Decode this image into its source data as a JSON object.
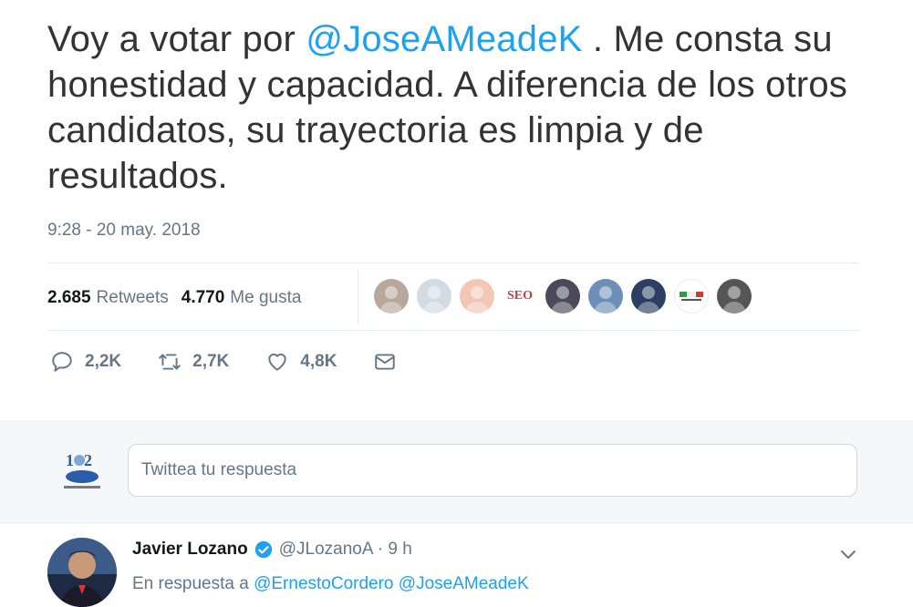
{
  "tweet": {
    "text_part1": "Voy a votar por ",
    "mention": "@JoseAMeadeK",
    "text_part2": " . Me consta su honestidad y capacidad. A diferencia de los otros candidatos, su trayectoria es limpia y de resultados.",
    "timestamp": "9:28 - 20 may. 2018"
  },
  "stats": {
    "retweets_count": "2.685",
    "retweets_label": "Retweets",
    "likes_count": "4.770",
    "likes_label": "Me gusta",
    "liker_avatars": [
      {
        "label": "",
        "bg": "#b9a79b"
      },
      {
        "label": "",
        "bg": "#d2dbe3"
      },
      {
        "label": "",
        "bg": "#f3c7b4"
      },
      {
        "label": "SEO",
        "bg": "#ffffff"
      },
      {
        "label": "",
        "bg": "#4a4a5a"
      },
      {
        "label": "",
        "bg": "#6c8fb8"
      },
      {
        "label": "",
        "bg": "#2c3e63"
      },
      {
        "label": "",
        "bg": "#ffffff"
      },
      {
        "label": "",
        "bg": "#555555"
      }
    ]
  },
  "actions": {
    "reply_count": "2,2K",
    "retweet_count": "2,7K",
    "like_count": "4,8K",
    "icons": [
      "reply-icon",
      "retweet-icon",
      "heart-icon",
      "message-icon"
    ]
  },
  "reply_box": {
    "placeholder": "Twittea tu respuesta"
  },
  "reply_tweet": {
    "author_name": "Javier Lozano",
    "author_meta": "@JLozanoA · 9 h",
    "in_reply_prefix": "En respuesta a ",
    "in_reply_mentions": "@ErnestoCordero @JoseAMeadeK"
  },
  "colors": {
    "link": "#1da1f2",
    "muted": "#657786",
    "text": "#14171a"
  }
}
